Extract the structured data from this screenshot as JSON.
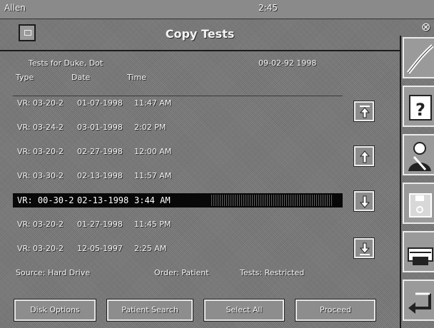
{
  "status_bar": {
    "left": "Allen",
    "right": "2:45"
  },
  "window": {
    "title": "Copy Tests"
  },
  "list": {
    "label": "Tests for Duke, Dot",
    "date_range": "09-02-92 1998",
    "columns": {
      "type": "Type",
      "date": "Date",
      "time": "Time"
    },
    "rows": [
      {
        "type": "VR: 03-20-2",
        "date": "01-07-1998",
        "time": "11:47 AM"
      },
      {
        "type": "VR: 03-24-2",
        "date": "03-01-1998",
        "time": "2:02 PM"
      },
      {
        "type": "VR: 03-20-2",
        "date": "02-27-1998",
        "time": "12:00 AM"
      },
      {
        "type": "VR: 03-30-2",
        "date": "02-13-1998",
        "time": "11:57 AM"
      },
      {
        "type": "VR: 00-30-2",
        "date": "02-13-1998",
        "time": "3:44 AM"
      },
      {
        "type": "VR: 03-20-2",
        "date": "01-27-1998",
        "time": "11:45 PM"
      },
      {
        "type": "VR: 03-20-2",
        "date": "12-05-1997",
        "time": "2:25 AM"
      }
    ],
    "selected_index": 4
  },
  "footer": {
    "source": "Source: Hard Drive",
    "order": "Order: Patient",
    "restriction": "Tests: Restricted"
  },
  "buttons": {
    "disk_options": "Disk Options",
    "patient_search": "Patient Search",
    "select_all": "Select All",
    "proceed": "Proceed"
  },
  "icons": {
    "scroll_top": "scroll-top-icon",
    "scroll_up": "scroll-up-icon",
    "scroll_down": "scroll-down-icon",
    "scroll_bottom": "scroll-bottom-icon",
    "sidebar": [
      "pen-icon",
      "help-icon",
      "person-icon",
      "disk-icon",
      "printer-icon",
      "back-icon"
    ]
  },
  "colors": {
    "selected_row": "#080808",
    "background": "#7e7e7e"
  }
}
